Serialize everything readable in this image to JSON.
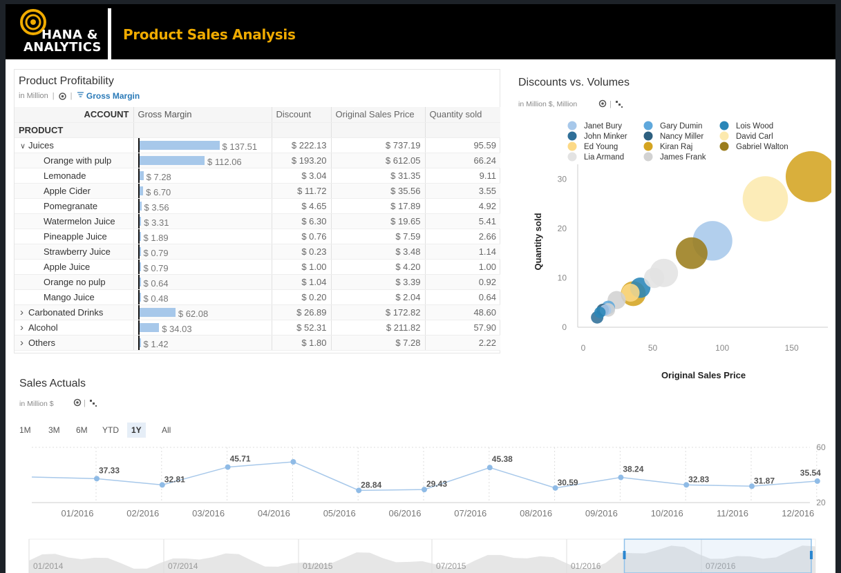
{
  "header": {
    "logo_line1": "HANA &",
    "logo_line2": "ANALYTICS",
    "title": "Product Sales Analysis"
  },
  "colors": {
    "accent": "#f0ab00",
    "bar": "#a7c8ea",
    "line": "#a7c8ea"
  },
  "profitability": {
    "title": "Product Profitability",
    "unit": "in Million",
    "filter_label": "Gross Margin",
    "columns": [
      "ACCOUNT",
      "Gross Margin",
      "Discount",
      "Original Sales Price",
      "Quantity sold"
    ],
    "dimension": "PRODUCT",
    "rows": [
      {
        "label": "Juices",
        "level": 1,
        "expand": "v",
        "gm": 137.51,
        "gm_text": "$ 137.51",
        "discount": "$ 222.13",
        "price": "$ 737.19",
        "qty": "95.59"
      },
      {
        "label": "Orange with pulp",
        "level": 2,
        "expand": "",
        "gm": 112.06,
        "gm_text": "$ 112.06",
        "discount": "$ 193.20",
        "price": "$ 612.05",
        "qty": "66.24"
      },
      {
        "label": "Lemonade",
        "level": 2,
        "expand": "",
        "gm": 7.28,
        "gm_text": "$ 7.28",
        "discount": "$ 3.04",
        "price": "$ 31.35",
        "qty": "9.11"
      },
      {
        "label": "Apple Cider",
        "level": 2,
        "expand": "",
        "gm": 6.7,
        "gm_text": "$ 6.70",
        "discount": "$ 11.72",
        "price": "$ 35.56",
        "qty": "3.55"
      },
      {
        "label": "Pomegranate",
        "level": 2,
        "expand": "",
        "gm": 3.56,
        "gm_text": "$ 3.56",
        "discount": "$ 4.65",
        "price": "$ 17.89",
        "qty": "4.92"
      },
      {
        "label": "Watermelon Juice",
        "level": 2,
        "expand": "",
        "gm": 3.31,
        "gm_text": "$ 3.31",
        "discount": "$ 6.30",
        "price": "$ 19.65",
        "qty": "5.41"
      },
      {
        "label": "Pineapple Juice",
        "level": 2,
        "expand": "",
        "gm": 1.89,
        "gm_text": "$ 1.89",
        "discount": "$ 0.76",
        "price": "$ 7.59",
        "qty": "2.66"
      },
      {
        "label": "Strawberry Juice",
        "level": 2,
        "expand": "",
        "gm": 0.79,
        "gm_text": "$ 0.79",
        "discount": "$ 0.23",
        "price": "$ 3.48",
        "qty": "1.14"
      },
      {
        "label": "Apple Juice",
        "level": 2,
        "expand": "",
        "gm": 0.79,
        "gm_text": "$ 0.79",
        "discount": "$ 1.00",
        "price": "$ 4.20",
        "qty": "1.00"
      },
      {
        "label": "Orange no pulp",
        "level": 2,
        "expand": "",
        "gm": 0.64,
        "gm_text": "$ 0.64",
        "discount": "$ 1.04",
        "price": "$ 3.39",
        "qty": "0.92"
      },
      {
        "label": "Mango Juice",
        "level": 2,
        "expand": "",
        "gm": 0.48,
        "gm_text": "$ 0.48",
        "discount": "$ 0.20",
        "price": "$ 2.04",
        "qty": "0.64"
      },
      {
        "label": "Carbonated Drinks",
        "level": 1,
        "expand": ">",
        "gm": 62.08,
        "gm_text": "$ 62.08",
        "discount": "$ 26.89",
        "price": "$ 172.82",
        "qty": "48.60"
      },
      {
        "label": "Alcohol",
        "level": 1,
        "expand": ">",
        "gm": 34.03,
        "gm_text": "$ 34.03",
        "discount": "$ 52.31",
        "price": "$ 211.82",
        "qty": "57.90"
      },
      {
        "label": "Others",
        "level": 1,
        "expand": ">",
        "gm": 1.42,
        "gm_text": "$ 1.42",
        "discount": "$ 1.80",
        "price": "$ 7.28",
        "qty": "2.22"
      }
    ]
  },
  "chart_data": [
    {
      "type": "scatter",
      "title": "Discounts vs. Volumes",
      "subtitle": "in Million $, Million",
      "xlabel": "Original Sales Price",
      "ylabel": "Quantity sold",
      "xlim": [
        0,
        180
      ],
      "ylim": [
        0,
        33
      ],
      "x_ticks": [
        "0",
        "50",
        "100",
        "150"
      ],
      "y_ticks": [
        "0",
        "10",
        "20",
        "30"
      ],
      "legend_position": "top",
      "series": [
        {
          "name": "Janet Bury",
          "color": "#a7c8ea",
          "points": [
            {
              "x": 97,
              "y": 17.5,
              "size": 35
            },
            {
              "x": 20,
              "y": 3.5,
              "size": 10
            }
          ]
        },
        {
          "name": "Gary Dumin",
          "color": "#5fa8dc",
          "points": [
            {
              "x": 22,
              "y": 4,
              "size": 12
            }
          ]
        },
        {
          "name": "Lois Wood",
          "color": "#2a86b8",
          "points": [
            {
              "x": 45,
              "y": 8,
              "size": 18
            },
            {
              "x": 16,
              "y": 3,
              "size": 10
            }
          ]
        },
        {
          "name": "John Minker",
          "color": "#2f6f98",
          "points": [
            {
              "x": 14,
              "y": 2,
              "size": 11
            }
          ]
        },
        {
          "name": "Nancy Miller",
          "color": "#2d5f7f",
          "points": [
            {
              "x": 18,
              "y": 3.5,
              "size": 11
            }
          ]
        },
        {
          "name": "David Carl",
          "color": "#fce9ae",
          "points": [
            {
              "x": 135,
              "y": 26,
              "size": 40
            }
          ]
        },
        {
          "name": "Ed Young",
          "color": "#fcd986",
          "points": [
            {
              "x": 38,
              "y": 7,
              "size": 16
            }
          ]
        },
        {
          "name": "Kiran Raj",
          "color": "#d4a421",
          "points": [
            {
              "x": 168,
              "y": 30.5,
              "size": 45
            },
            {
              "x": 40,
              "y": 6.8,
              "size": 22
            }
          ]
        },
        {
          "name": "Gabriel Walton",
          "color": "#9b7d1d",
          "points": [
            {
              "x": 82,
              "y": 15,
              "size": 28
            }
          ]
        },
        {
          "name": "Lia Armand",
          "color": "#e3e3e3",
          "points": [
            {
              "x": 62,
              "y": 11,
              "size": 25
            },
            {
              "x": 55,
              "y": 10,
              "size": 18
            }
          ]
        },
        {
          "name": "James Frank",
          "color": "#d2d2d2",
          "points": [
            {
              "x": 28,
              "y": 5.5,
              "size": 16
            },
            {
              "x": 22,
              "y": 3.5,
              "size": 12
            }
          ]
        }
      ]
    },
    {
      "type": "line",
      "title": "Sales Actuals",
      "subtitle": "in Million $",
      "categories": [
        "01/2016",
        "02/2016",
        "03/2016",
        "04/2016",
        "05/2016",
        "06/2016",
        "07/2016",
        "08/2016",
        "09/2016",
        "10/2016",
        "11/2016",
        "12/2016"
      ],
      "leading_value": 38.5,
      "values": [
        37.33,
        32.81,
        45.71,
        49.5,
        28.84,
        29.43,
        45.38,
        30.59,
        38.24,
        32.83,
        31.87,
        35.54
      ],
      "value_labels": [
        "37.33",
        "32.81",
        "45.71",
        "",
        "28.84",
        "29.43",
        "45.38",
        "30.59",
        "38.24",
        "32.83",
        "31.87",
        "35.54"
      ],
      "ylim": [
        20,
        60
      ],
      "y_ticks": [
        "20",
        "60"
      ],
      "range_buttons": [
        "1M",
        "3M",
        "6M",
        "YTD",
        "1Y",
        "All"
      ],
      "active_range": "1Y",
      "navigator_labels": [
        "01/2014",
        "07/2014",
        "01/2015",
        "07/2015",
        "01/2016",
        "07/2016"
      ],
      "navigator_selection": [
        0.75,
        1.0
      ]
    }
  ]
}
